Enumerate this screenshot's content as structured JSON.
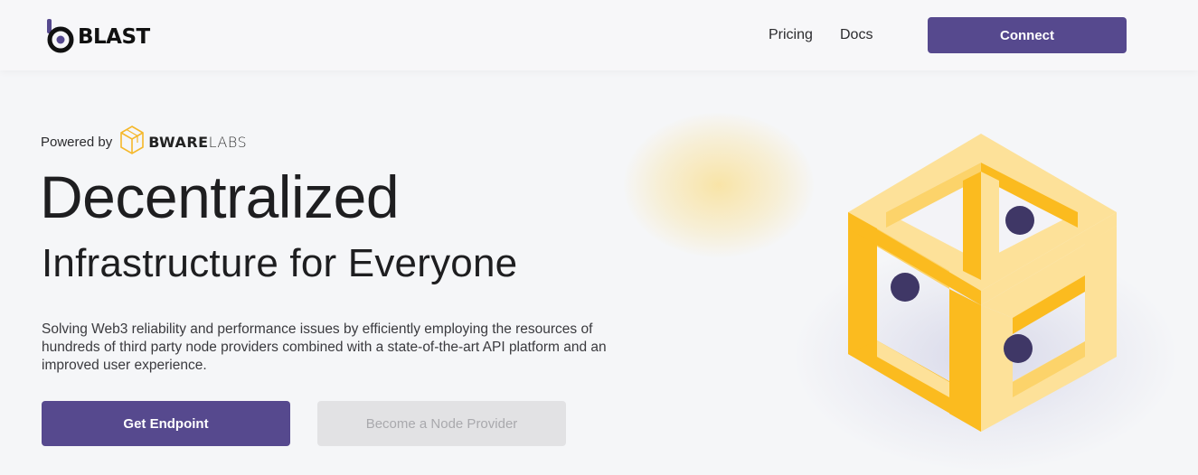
{
  "header": {
    "brand": "BLAST",
    "nav": [
      {
        "label": "Pricing"
      },
      {
        "label": "Docs"
      }
    ],
    "connect_label": "Connect"
  },
  "hero": {
    "powered_by": "Powered by",
    "partner_bold": "BWARE",
    "partner_light": "LABS",
    "title": "Decentralized",
    "subtitle": "Infrastructure for Everyone",
    "description": "Solving Web3 reliability and performance issues by efficiently employing the resources of hundreds of third party node providers combined with a state-of-the-art API platform and an improved user experience.",
    "primary_cta": "Get Endpoint",
    "secondary_cta": "Become a Node Provider"
  },
  "colors": {
    "accent": "#56498e",
    "cube_yellow": "#fbbb1f",
    "cube_light": "#fde199",
    "sphere": "#3f3766",
    "background": "#f5f6f8"
  },
  "icons": [
    "blast-logo-icon",
    "bwarelabs-cube-icon",
    "hero-cube-illustration"
  ]
}
